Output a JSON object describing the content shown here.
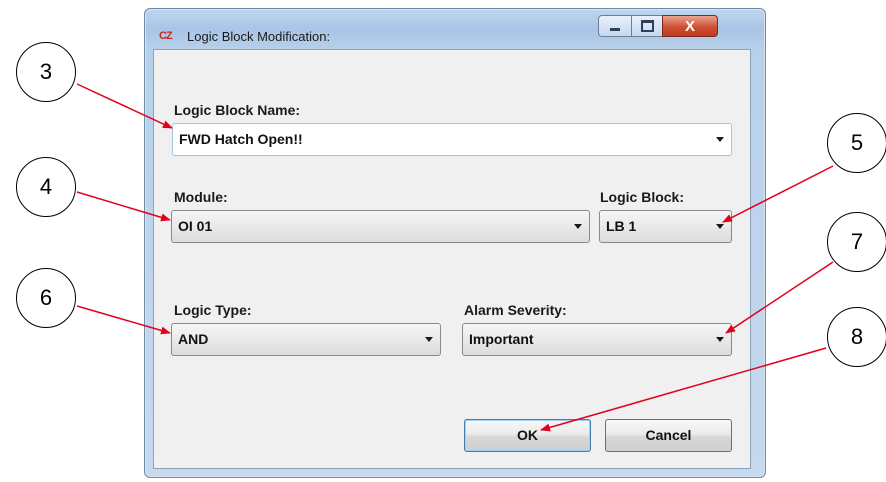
{
  "window": {
    "title": "Logic Block Modification:",
    "app_icon_text": "CZ",
    "close_glyph": "X"
  },
  "form": {
    "name_label": "Logic Block Name:",
    "name_value": "FWD Hatch Open!!",
    "module_label": "Module:",
    "module_value": "OI 01",
    "logic_block_label": "Logic Block:",
    "logic_block_value": "LB 1",
    "logic_type_label": "Logic Type:",
    "logic_type_value": "AND",
    "alarm_severity_label": "Alarm Severity:",
    "alarm_severity_value": "Important"
  },
  "buttons": {
    "ok_label": "OK",
    "cancel_label": "Cancel"
  },
  "callouts": [
    "3",
    "4",
    "5",
    "6",
    "7",
    "8"
  ],
  "colors": {
    "callout_arrow": "#e3001b",
    "title_bar": "#b8d0ea",
    "close_button": "#cf4f32",
    "dialog_background": "#f0f0f0"
  }
}
